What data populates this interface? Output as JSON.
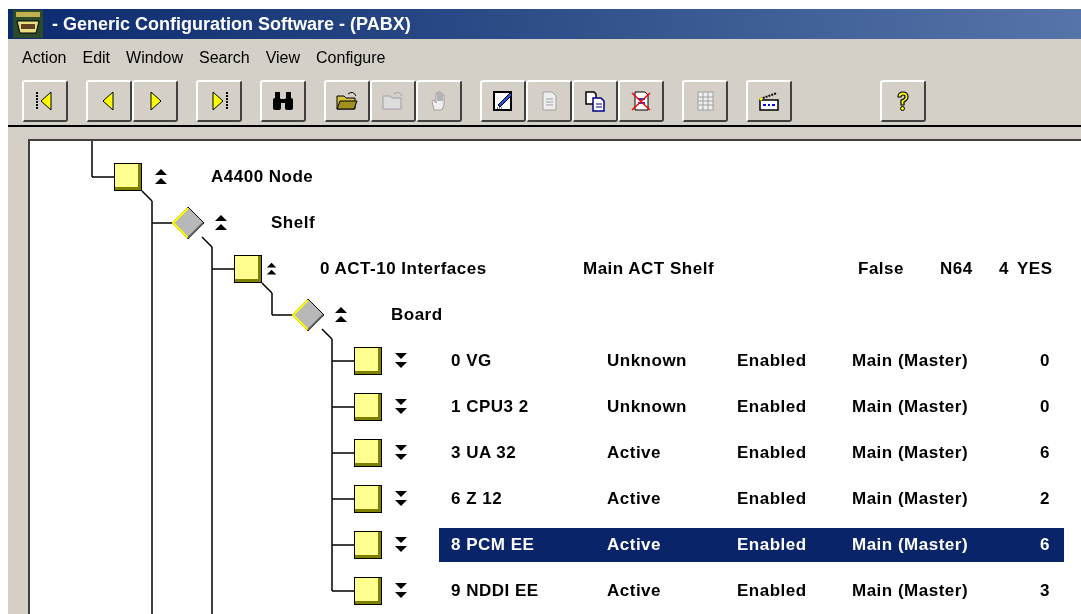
{
  "window": {
    "title": "- Generic Configuration Software - (PABX)"
  },
  "menu": [
    "Action",
    "Edit",
    "Window",
    "Search",
    "View",
    "Configure"
  ],
  "toolbar": [
    [
      {
        "kind": "first",
        "disabled": false
      }
    ],
    [
      {
        "kind": "previous",
        "disabled": false
      },
      {
        "kind": "next",
        "disabled": false
      }
    ],
    [
      {
        "kind": "last",
        "disabled": false
      }
    ],
    [
      {
        "kind": "find",
        "disabled": false
      }
    ],
    [
      {
        "kind": "open",
        "disabled": false
      },
      {
        "kind": "save",
        "disabled": true
      },
      {
        "kind": "stop",
        "disabled": true
      }
    ],
    [
      {
        "kind": "edit",
        "disabled": false
      },
      {
        "kind": "new",
        "disabled": true
      },
      {
        "kind": "copy",
        "disabled": false
      },
      {
        "kind": "delete",
        "disabled": false
      }
    ],
    [
      {
        "kind": "table",
        "disabled": true
      }
    ],
    [
      {
        "kind": "action",
        "disabled": false
      }
    ],
    [
      {
        "kind": "help",
        "disabled": false
      }
    ]
  ],
  "tree": [
    {
      "label": "A4400 Node",
      "kind": "item",
      "expanded": true,
      "continues": true,
      "selected": false,
      "children": [
        {
          "label": "Shelf",
          "kind": "group",
          "expanded": true,
          "continues": true,
          "selected": false,
          "children": [
            {
              "label": "0 ACT-10 Interfaces",
              "kind": "item",
              "expanded": true,
              "continues": false,
              "selected": false,
              "cells": [
                "Main ACT Shelf",
                "False",
                "N64",
                "4",
                "YES"
              ],
              "children": [
                {
                  "label": "Board",
                  "kind": "group",
                  "expanded": true,
                  "continues": false,
                  "selected": false,
                  "children": [
                    {
                      "label": "0 VG",
                      "kind": "item",
                      "expanded": false,
                      "selected": false,
                      "cells": [
                        "Unknown",
                        "Enabled",
                        "Main (Master)",
                        "0"
                      ]
                    },
                    {
                      "label": "1 CPU3 2",
                      "kind": "item",
                      "expanded": false,
                      "selected": false,
                      "cells": [
                        "Unknown",
                        "Enabled",
                        "Main (Master)",
                        "0"
                      ]
                    },
                    {
                      "label": "3 UA 32",
                      "kind": "item",
                      "expanded": false,
                      "selected": false,
                      "cells": [
                        "Active",
                        "Enabled",
                        "Main (Master)",
                        "6"
                      ]
                    },
                    {
                      "label": "6 Z 12",
                      "kind": "item",
                      "expanded": false,
                      "selected": false,
                      "cells": [
                        "Active",
                        "Enabled",
                        "Main (Master)",
                        "2"
                      ]
                    },
                    {
                      "label": "8 PCM EE",
                      "kind": "item",
                      "expanded": false,
                      "selected": true,
                      "cells": [
                        "Active",
                        "Enabled",
                        "Main (Master)",
                        "6"
                      ]
                    },
                    {
                      "label": "9 NDDI EE",
                      "kind": "item",
                      "expanded": false,
                      "selected": false,
                      "cells": [
                        "Active",
                        "Enabled",
                        "Main (Master)",
                        "3"
                      ]
                    }
                  ]
                }
              ]
            }
          ]
        }
      ]
    }
  ]
}
